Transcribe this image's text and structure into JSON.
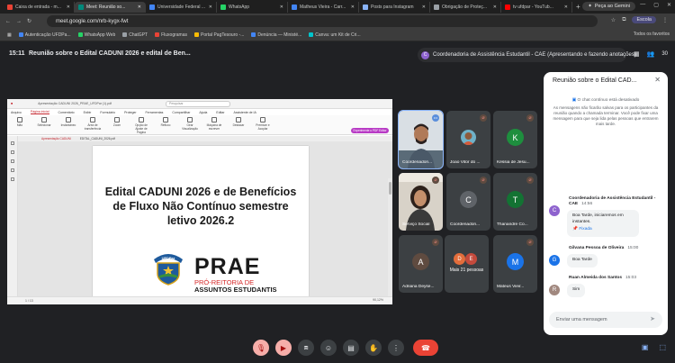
{
  "browser": {
    "tabs": [
      {
        "label": "Caixa de entrada - m...",
        "color": "#ea4335",
        "active": false
      },
      {
        "label": "Meet: Reunião so...",
        "color": "#00897b",
        "active": true
      },
      {
        "label": "Universidade Federal ...",
        "color": "#4285f4",
        "active": false
      },
      {
        "label": "WhatsApp",
        "color": "#25d366",
        "active": false
      },
      {
        "label": "Matheus Vieira - Carr...",
        "color": "#4285f4",
        "active": false
      },
      {
        "label": "Posts para Instagram",
        "color": "#8ab4f8",
        "active": false
      },
      {
        "label": "Obrigação de Proteç...",
        "color": "#9aa0a6",
        "active": false
      },
      {
        "label": "tv ufdpar - YouTub...",
        "color": "#ff0000",
        "active": false
      }
    ],
    "gemini_label": "Peça ao Gemini",
    "url": "meet.google.com/nrb-kygx-fwt",
    "profile": "Escola",
    "bookmarks": [
      {
        "label": "Autenticação UFDPa...",
        "color": "#4285f4"
      },
      {
        "label": "WhatsApp Web",
        "color": "#25d366"
      },
      {
        "label": "ChatGPT",
        "color": "#9aa0a6"
      },
      {
        "label": "Fluxogramas",
        "color": "#ea4335"
      },
      {
        "label": "Portal PagTesouro -...",
        "color": "#fbbc04"
      },
      {
        "label": "Denúncia — Ministé...",
        "color": "#4285f4"
      },
      {
        "label": "Canva: um Kit de Cri...",
        "color": "#00c4cc"
      }
    ],
    "all_bookmarks": "Todos os favoritos"
  },
  "meeting": {
    "time": "15:11",
    "title": "Reunião sobre o Edital CADUNI 2026 e edital de Ben...",
    "presenter": "Coordenadoria de Assistência Estudantil - CAE (Apresentando e fazendo anotações)",
    "presenter_initial": "C",
    "participant_count": "30"
  },
  "shared_screen": {
    "doc_tab": "Apresentação CADUNI 2026_PRAE_UFDPar (1).pdf",
    "search_placeholder": "Pesquisar",
    "menu_tabs": [
      "Arquivo",
      "Página inicial",
      "Comentário",
      "Exibir",
      "Formulário",
      "Proteger",
      "Ferramentas",
      "Compartilhar",
      "Ajuda",
      "Editar",
      "Assistente de IA"
    ],
    "ribbon": [
      "Mão",
      "Selecionar",
      "Instantâneo",
      "Área de transferência",
      "Zoom",
      "Opção de Ajuste de Página",
      "Refluxo",
      "Girar Visualização",
      "Máquina de escrever",
      "Destacar",
      "Premium e Acoplar"
    ],
    "pro_badge": "Experimente o PDF Editor Pro",
    "doc_tabs": [
      "Apresentação CADUNI",
      "EDITAL_CADUNI_2026.pdf"
    ],
    "doc_title_line1": "Edital CADUNI 2026 e de Benefícios",
    "doc_title_line2": "de Fluxo Não Contínuo semestre",
    "doc_title_line3": "letivo 2026.2",
    "logo_word": "PRAE",
    "logo_sub1": "PRÓ-REITORIA DE",
    "logo_sub2": "ASSUNTOS ESTUDANTIS",
    "seal_text": "UFDPar",
    "page_indicator": "1 / 13",
    "zoom": "90,12%"
  },
  "participants": [
    {
      "name": "Coordenadori...",
      "initial": "",
      "color": "#3c4043",
      "kind": "video-man"
    },
    {
      "name": "Joao Vitor do ...",
      "initial": "",
      "color": "#3c4043",
      "kind": "photo"
    },
    {
      "name": "Késsia de Jesu...",
      "initial": "K",
      "color": "#1e8e3e",
      "kind": "avatar"
    },
    {
      "name": "Serviço Social",
      "initial": "",
      "color": "#3c4043",
      "kind": "video-woman"
    },
    {
      "name": "Coordenadori...",
      "initial": "C",
      "color": "#5f6368",
      "kind": "avatar"
    },
    {
      "name": "Thanandre Co...",
      "initial": "T",
      "color": "#137333",
      "kind": "avatar"
    },
    {
      "name": "Adriana Deyse...",
      "initial": "A",
      "color": "#5f6368",
      "kind": "avatar-brown"
    },
    {
      "name": "Mateus Vieir...",
      "initial": "M",
      "color": "#1a73e8",
      "kind": "avatar"
    }
  ],
  "more_people": {
    "d1": "D",
    "d2": "E",
    "label": "Mais 21 pessoas"
  },
  "chat": {
    "title": "Reunião sobre o Edital CAD...",
    "notice_header": "O chat contínuo está desativado",
    "notice": "As mensagens não ficarão salvas para os participantes da reunião quando a chamada terminar. Você pode fixar uma mensagem para que seja lida pelas pessoas que entrarem mais tarde.",
    "messages": [
      {
        "sender": "Coordenadoria de Assistência Estudantil - CAE",
        "time": "14:56",
        "initial": "C",
        "color": "#8e63ce",
        "texts": [
          "Boa Tarde, iniciaremos em instantes."
        ],
        "pinned": "Fixada"
      },
      {
        "sender": "Gilvana Pessoa de Oliveira",
        "time": "15:00",
        "initial": "G",
        "color": "#1a73e8",
        "texts": [
          "Boa Tarde"
        ],
        "pinned": ""
      },
      {
        "sender": "Ruan Almeida dos Santos",
        "time": "15:03",
        "initial": "R",
        "color": "#795548",
        "texts": [
          "Sim"
        ],
        "pinned": ""
      }
    ],
    "input_placeholder": "Enviar uma mensagem"
  },
  "controls": [
    "mic-off",
    "camera-off",
    "present",
    "emoji",
    "captions",
    "raise-hand",
    "more",
    "leave"
  ]
}
